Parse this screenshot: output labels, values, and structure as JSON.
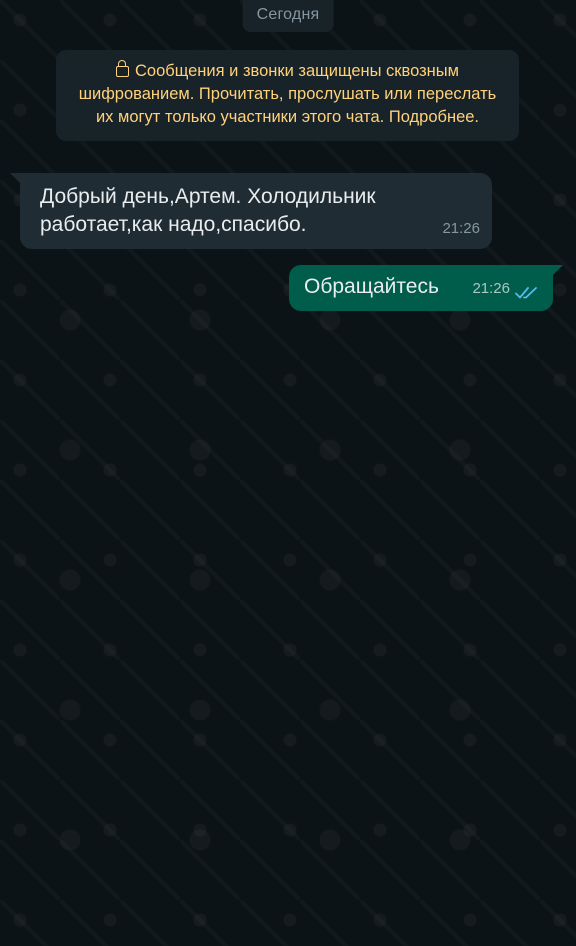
{
  "chat": {
    "date_chip": "Сегодня",
    "encryption_notice": "Сообщения и звонки защищены сквозным шифрованием. Прочитать, прослушать или переслать их могут только участники этого чата. Подробнее.",
    "messages": [
      {
        "direction": "incoming",
        "text": "Добрый день,Артем. Холодильник работает,как надо,спасибо.",
        "time": "21:26"
      },
      {
        "direction": "outgoing",
        "text": "Обращайтесь",
        "time": "21:26",
        "status": "read",
        "status_icon": "double-check-icon"
      }
    ]
  },
  "colors": {
    "background": "#0b1014",
    "incoming_bubble": "#202c33",
    "outgoing_bubble": "#005c4b",
    "notice_text": "#ffd279",
    "read_ticks": "#53bdeb"
  }
}
